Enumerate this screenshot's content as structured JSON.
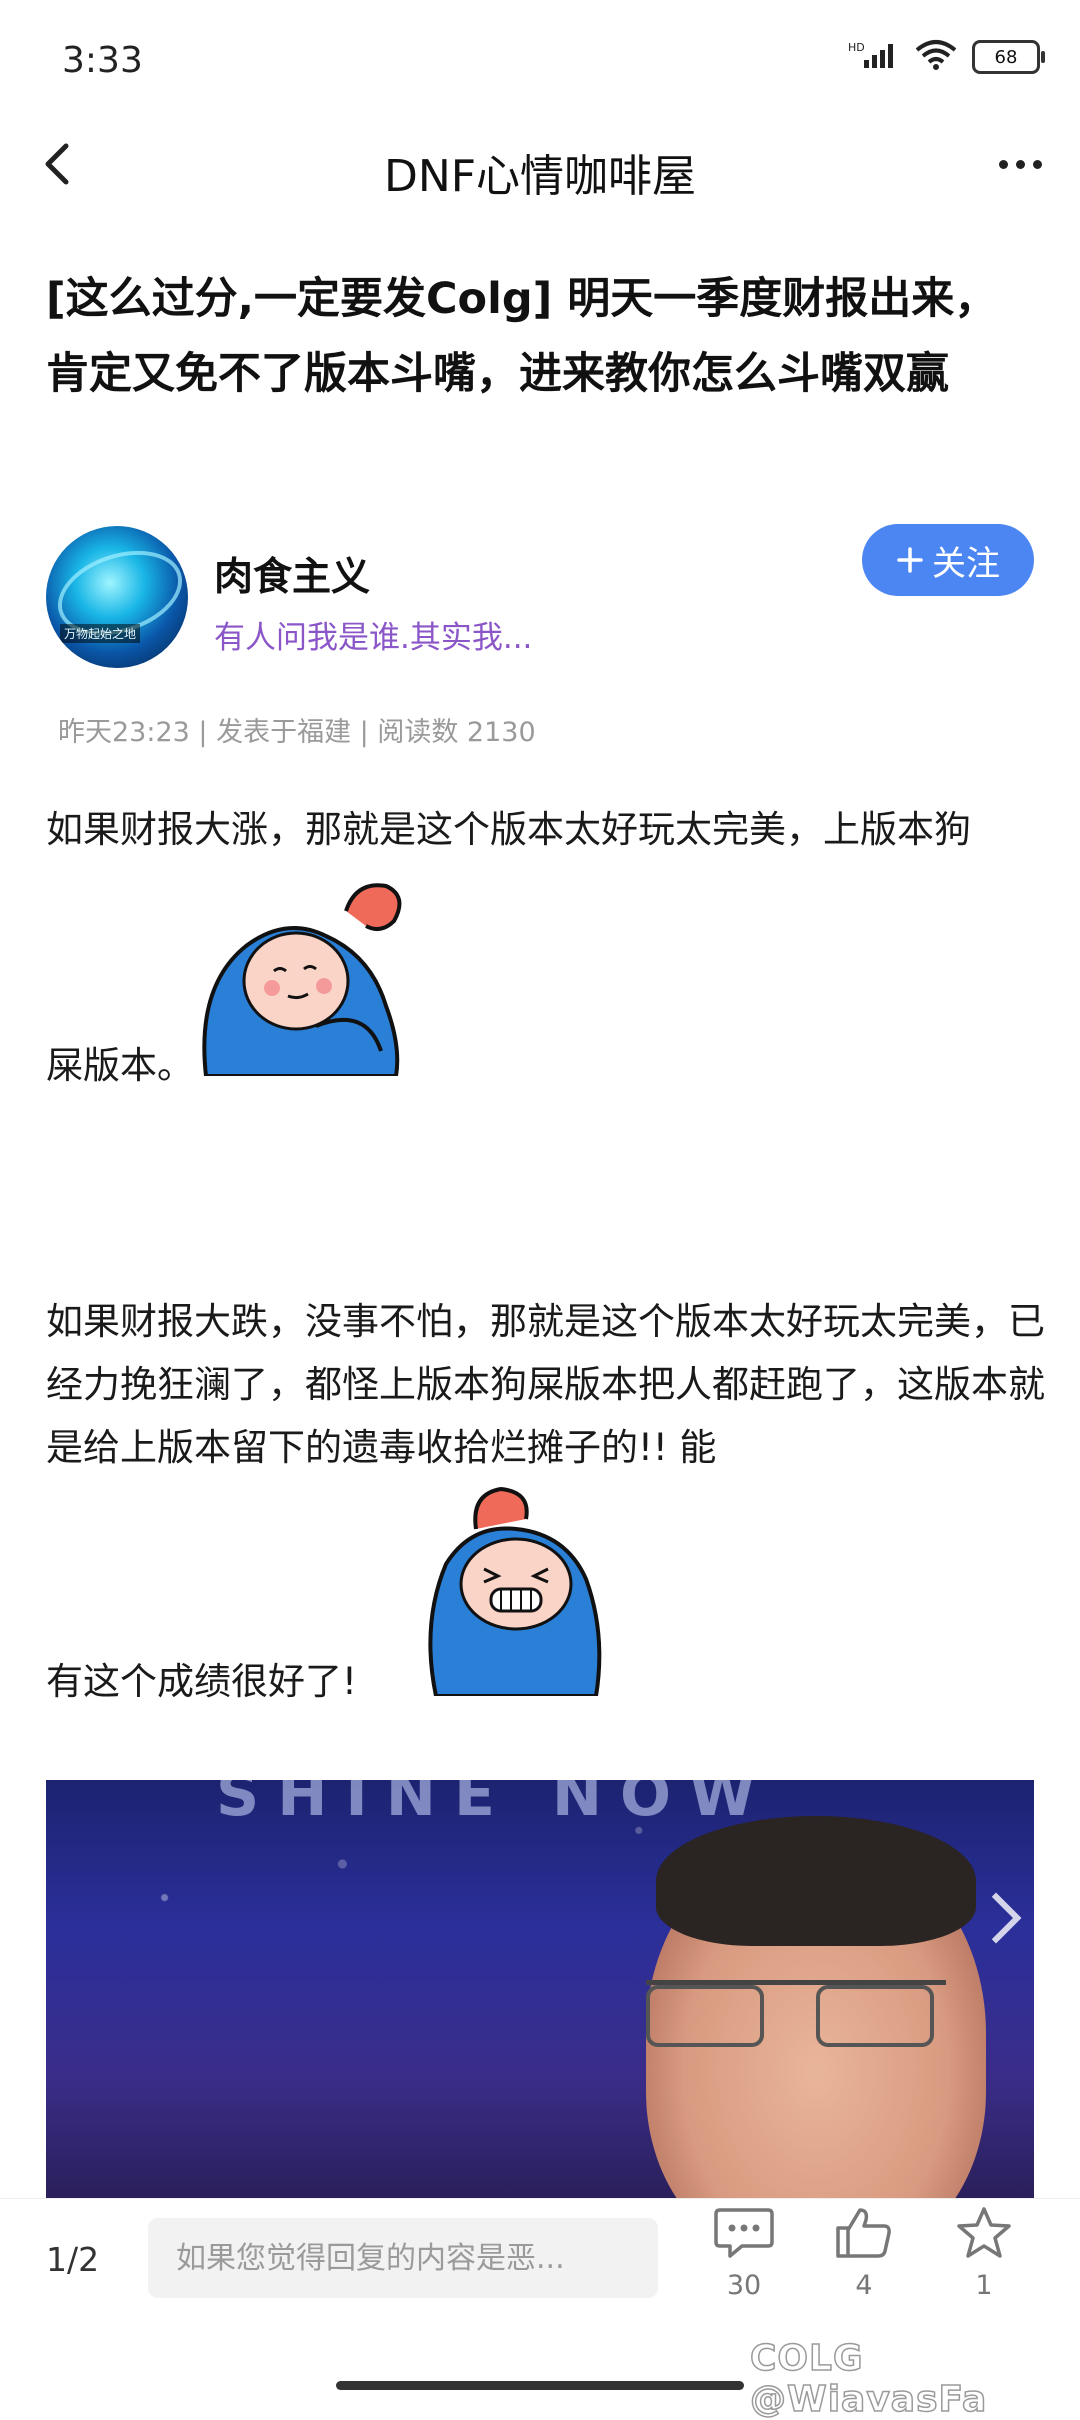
{
  "status_bar": {
    "time": "3:33",
    "network": "HD",
    "battery": "68"
  },
  "nav": {
    "title": "DNF心情咖啡屋",
    "back_icon": "chevron-left-icon",
    "more_icon": "more-dots-icon"
  },
  "post": {
    "title": "[这么过分,一定要发Colg] 明天一季度财报出来，肯定又免不了版本斗嘴，进来教你怎么斗嘴双赢",
    "author": {
      "name": "肉食主义",
      "signature": "有人问我是谁.其实我...",
      "avatar_caption": "万物起始之地",
      "follow_label": "关注"
    },
    "meta": "昨天23:23 | 发表于福建 | 阅读数 2130",
    "paragraphs": [
      "如果财报大涨，那就是这个版本太好玩太完美，上版本狗",
      "屎版本。",
      "如果财报大跌，没事不怕，那就是这个版本太好玩太完美，已经力挽狂澜了，都怪上版本狗屎版本把人都赶跑了，这版本就是给上版本留下的遗毒收拾烂摊子的!! 能",
      "有这个成绩很好了!"
    ],
    "image_stage_text": "SHINE NOW"
  },
  "bottom_bar": {
    "page": "1/2",
    "reply_placeholder": "如果您觉得回复的内容是恶...",
    "comments": "30",
    "likes": "4",
    "favorites": "1"
  },
  "watermark": "COLG @WiavasFa",
  "colors": {
    "accent": "#4b86f2",
    "signature": "#8a56c8",
    "meta": "#9a9a9a"
  }
}
